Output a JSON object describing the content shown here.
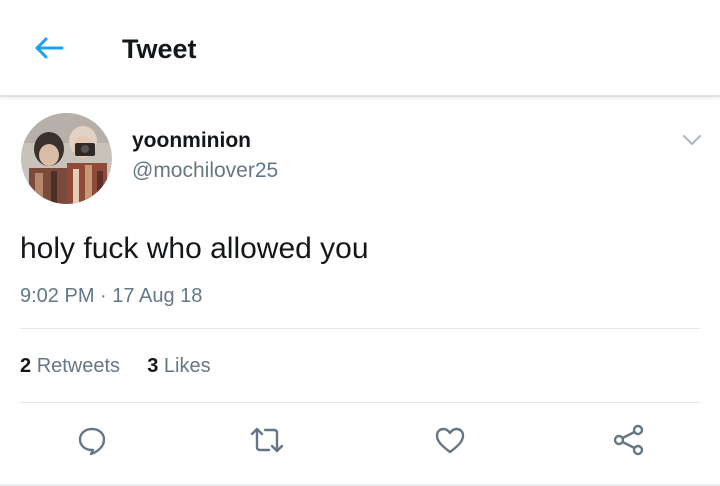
{
  "header": {
    "title": "Tweet",
    "back_icon": "arrow-left-icon",
    "accent_color": "#1da1f2"
  },
  "tweet": {
    "display_name": "yoonminion",
    "username": "@mochilover25",
    "text": "holy fuck who allowed you",
    "time": "9:02 PM",
    "separator": "·",
    "date": "17 Aug 18",
    "menu_icon": "chevron-down-icon"
  },
  "stats": {
    "retweets_count": "2",
    "retweets_label": "Retweets",
    "likes_count": "3",
    "likes_label": "Likes"
  },
  "actions": [
    {
      "icon": "reply-icon"
    },
    {
      "icon": "retweet-icon"
    },
    {
      "icon": "heart-icon"
    },
    {
      "icon": "share-icon"
    }
  ],
  "colors": {
    "text_primary": "#14171a",
    "text_secondary": "#657786",
    "divider": "#e1e8ed"
  }
}
